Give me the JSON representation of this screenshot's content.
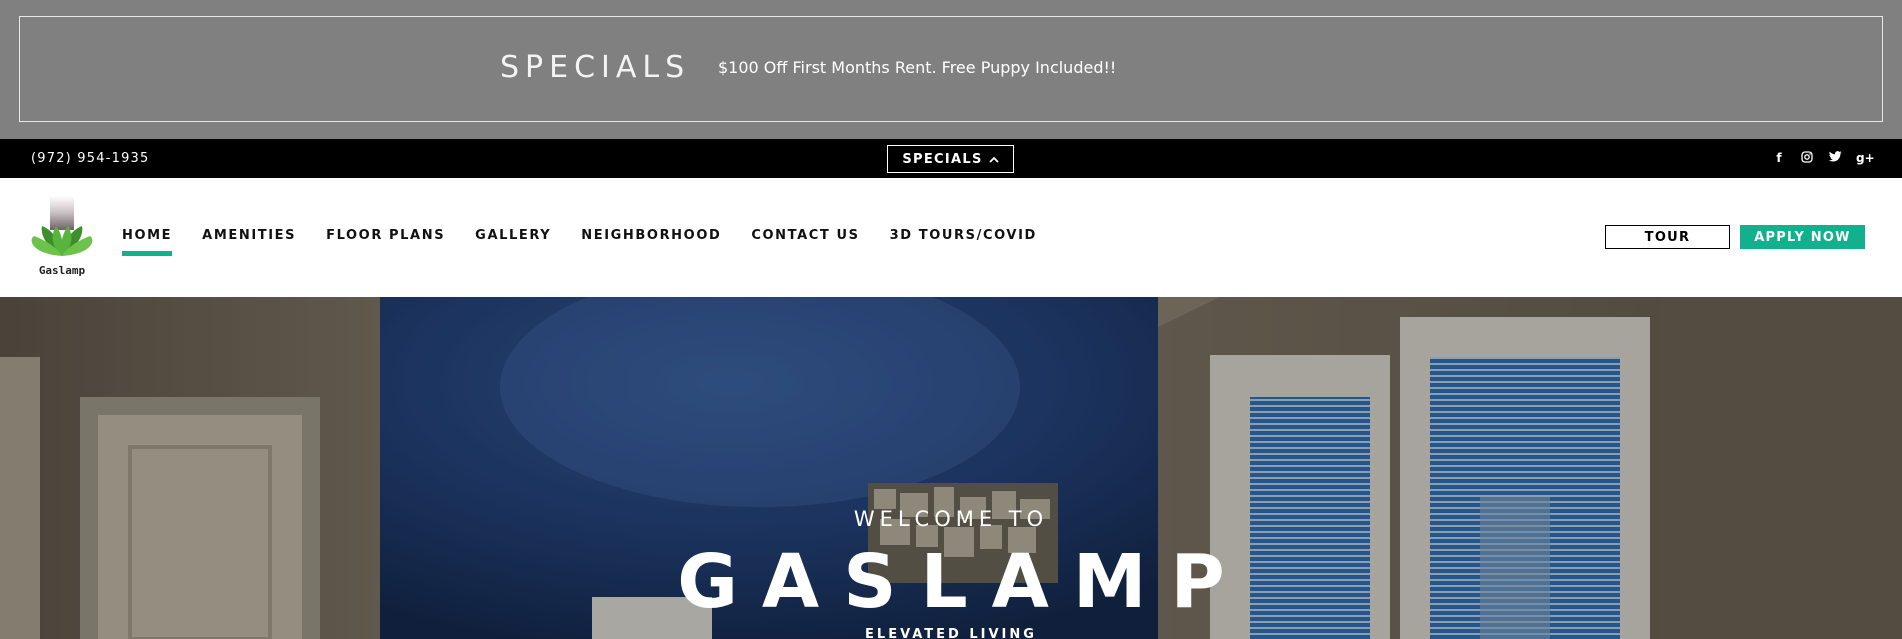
{
  "specials_banner": {
    "heading": "SPECIALS",
    "text": "$100 Off First Months Rent. Free Puppy Included!!"
  },
  "topbar": {
    "phone": "(972) 954-1935",
    "specials_toggle_label": "SPECIALS",
    "social_icons": [
      "facebook-icon",
      "instagram-icon",
      "twitter-icon",
      "google-plus-icon"
    ]
  },
  "navbar": {
    "logo_label": "Gaslamp",
    "items": [
      {
        "label": "HOME",
        "active": true
      },
      {
        "label": "AMENITIES"
      },
      {
        "label": "FLOOR PLANS"
      },
      {
        "label": "GALLERY"
      },
      {
        "label": "NEIGHBORHOOD"
      },
      {
        "label": "CONTACT US"
      },
      {
        "label": "3D TOURS/COVID"
      }
    ],
    "tour_label": "TOUR",
    "apply_label": "APPLY NOW"
  },
  "hero": {
    "welcome": "WELCOME TO",
    "title": "GASLAMP",
    "subtitle": "ELEVATED LIVING"
  },
  "colors": {
    "accent": "#12b08c",
    "banner_bg": "#808080",
    "topbar_bg": "#000000"
  }
}
